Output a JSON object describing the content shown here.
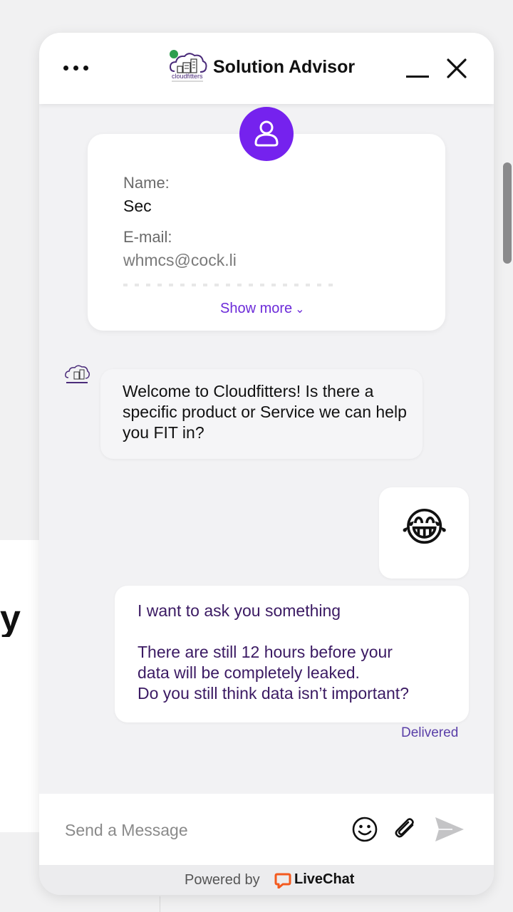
{
  "background": {
    "partial_letter": "y"
  },
  "header": {
    "title": "Solution Advisor",
    "logo_text": "cloudfitters",
    "status_color": "#2e9e4f",
    "icons": {
      "menu": "more-horizontal-icon",
      "minimize": "minimize-icon",
      "close": "close-icon"
    }
  },
  "prechat": {
    "avatar_icon": "user-icon",
    "avatar_color": "#7522ee",
    "fields": [
      {
        "label": "Name:",
        "value": "Sec"
      },
      {
        "label": "E-mail:",
        "value": "whmcs@cock.li"
      }
    ],
    "show_more": "Show more"
  },
  "messages": [
    {
      "author": "agent",
      "text": "Welcome to Cloudfitters! Is there a specific product or Service we can help you FIT in?"
    },
    {
      "author": "visitor",
      "text": "😂"
    },
    {
      "author": "visitor",
      "lines": [
        "I want to ask you something",
        "There are still 12 hours before your",
        "data will be completely leaked.",
        "Do you still think data isn’t important?"
      ]
    }
  ],
  "status": {
    "delivered": "Delivered"
  },
  "composer": {
    "placeholder": "Send a Message",
    "icons": {
      "emoji": "emoji-icon",
      "attach": "paperclip-icon",
      "send": "send-icon"
    }
  },
  "footer": {
    "powered_by": "Powered by",
    "brand": "LiveChat",
    "brand_color": "#f35a1f"
  },
  "colors": {
    "accent": "#7522ee",
    "link": "#6c2bd9",
    "visitor_text": "#3b1a63"
  }
}
